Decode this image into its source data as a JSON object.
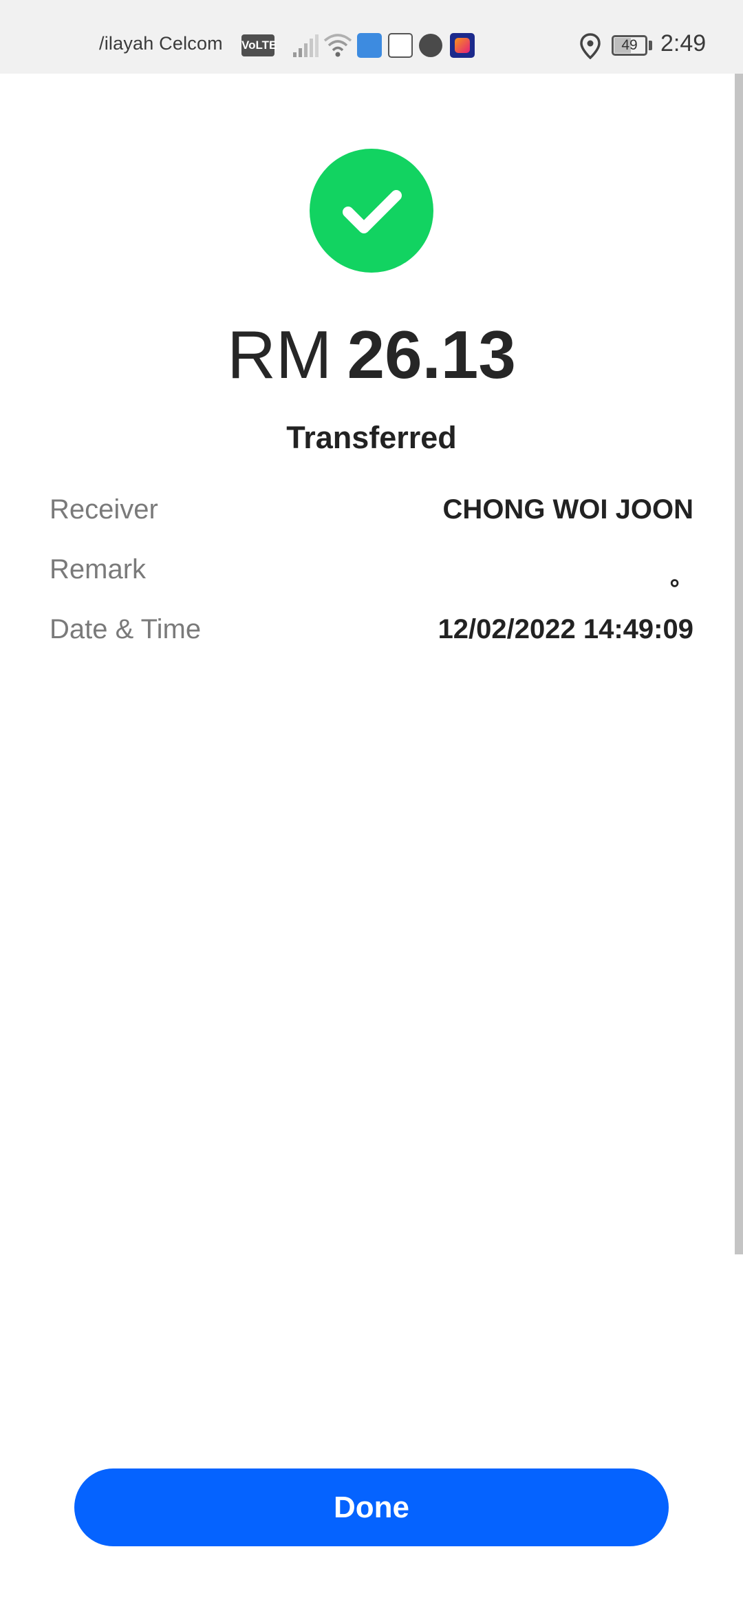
{
  "status_bar": {
    "carrier": "/ilayah Celcom",
    "volte_badge": "VoLTE",
    "battery_level": "49",
    "time": "2:49",
    "icons": [
      "signal-icon",
      "wifi-icon",
      "app-notification-icon",
      "touchngo-ewallet-icon",
      "messenger-icon",
      "lazada-icon",
      "location-icon",
      "battery-icon"
    ]
  },
  "result": {
    "icon": "check-icon",
    "icon_color": "#12d361",
    "currency": "RM",
    "amount": "26.13",
    "status": "Transferred"
  },
  "details": {
    "receiver": {
      "label": "Receiver",
      "value": "CHONG WOI JOON"
    },
    "remark": {
      "label": "Remark",
      "value": "。"
    },
    "datetime": {
      "label": "Date & Time",
      "value": "12/02/2022 14:49:09"
    }
  },
  "actions": {
    "done_label": "Done",
    "done_color": "#0563ff"
  }
}
